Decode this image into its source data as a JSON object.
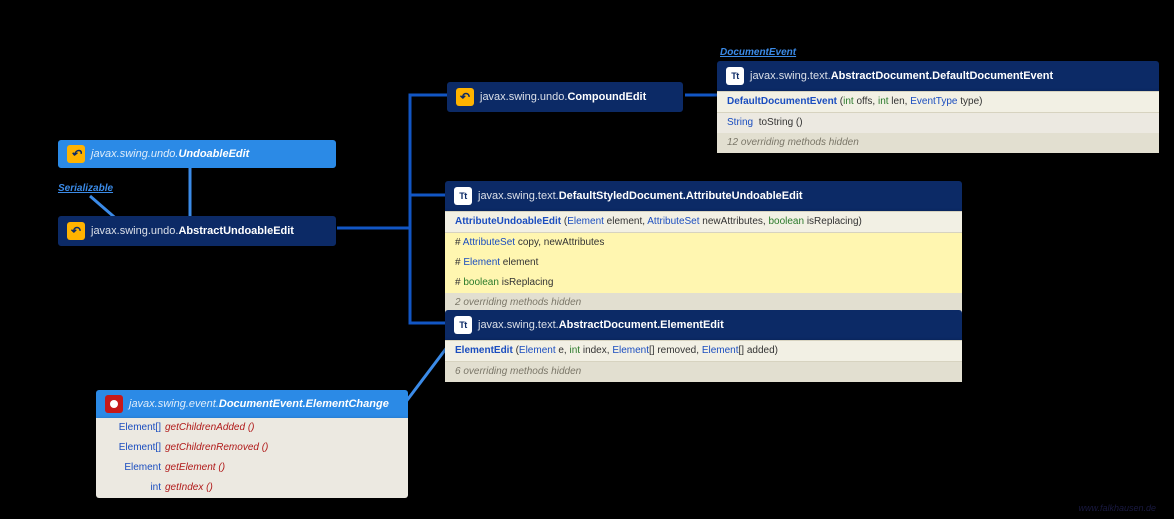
{
  "labels": {
    "serializable": "Serializable",
    "documentEvent": "DocumentEvent"
  },
  "undoableEdit": {
    "pkg": "javax.swing.undo.",
    "name": "UndoableEdit"
  },
  "abstractUndoableEdit": {
    "pkg": "javax.swing.undo.",
    "name": "AbstractUndoableEdit"
  },
  "compoundEdit": {
    "pkg": "javax.swing.undo.",
    "name": "CompoundEdit"
  },
  "defaultDocEvent": {
    "pkg": "javax.swing.text.",
    "name": "AbstractDocument.DefaultDocumentEvent",
    "ctor": {
      "name": "DefaultDocumentEvent",
      "paramsPrefix": " (",
      "p1t": "int",
      "p1": " offs, ",
      "p2t": "int",
      "p2": " len, ",
      "p3t": "EventType",
      "p3": " type)"
    },
    "m1ret": "String",
    "m1": "toString ()",
    "note": "12 overriding methods hidden"
  },
  "attrUndoable": {
    "pkg": "javax.swing.text.",
    "name": "DefaultStyledDocument.AttributeUndoableEdit",
    "ctor": {
      "name": "AttributeUndoableEdit",
      "open": " (",
      "p1t": "Element",
      "p1": " element, ",
      "p2t": "AttributeSet",
      "p2": " newAttributes, ",
      "p3t": "boolean",
      "p3": " isReplacing)"
    },
    "f1t": "AttributeSet",
    "f1": " copy, newAttributes",
    "f2t": "Element",
    "f2": " element",
    "f3t": "boolean",
    "f3": " isReplacing",
    "note": "2 overriding methods hidden"
  },
  "elementEdit": {
    "pkg": "javax.swing.text.",
    "name": "AbstractDocument.ElementEdit",
    "ctor": {
      "name": "ElementEdit",
      "open": " (",
      "p1t": "Element",
      "p1": " e, ",
      "p2t": "int",
      "p2": " index, ",
      "p3t": "Element",
      "p3": "[] removed, ",
      "p4t": "Element",
      "p4": "[] added)"
    },
    "note": "6 overriding methods hidden"
  },
  "elementChange": {
    "pkg": "javax.swing.event.",
    "name": "DocumentEvent.ElementChange",
    "r1t": "Element[]",
    "r1": "getChildrenAdded ()",
    "r2t": "Element[]",
    "r2": "getChildrenRemoved ()",
    "r3t": "Element",
    "r3": "getElement ()",
    "r4t": "int",
    "r4": "getIndex ()"
  },
  "watermark": "www.falkhausen.de",
  "glyphs": {
    "undo": "↶",
    "tt": "Tt"
  }
}
